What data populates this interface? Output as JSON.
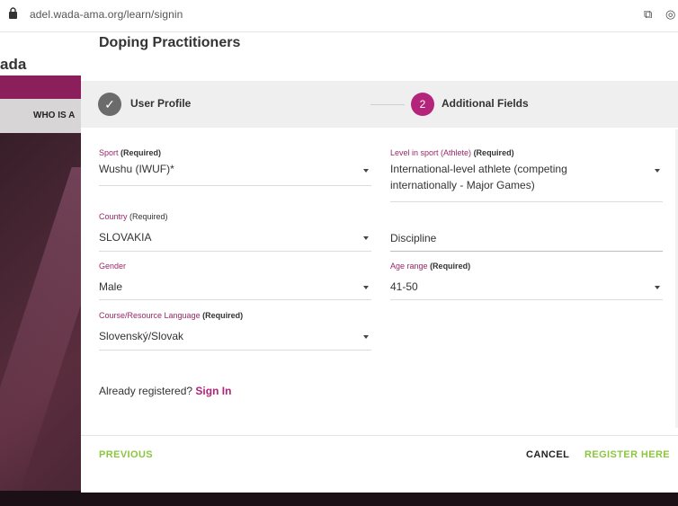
{
  "browser": {
    "url": "adel.wada-ama.org/learn/signin"
  },
  "background": {
    "logo_text": "ada",
    "nav_text": "WHO IS A"
  },
  "modal": {
    "title": "Doping Practitioners",
    "steps": [
      {
        "number": "✓",
        "label": "User Profile",
        "state": "complete"
      },
      {
        "number": "2",
        "label": "Additional Fields",
        "state": "active"
      }
    ],
    "fields": {
      "sport": {
        "label": "Sport",
        "required": "(Required)",
        "value": "Wushu (IWUF)*"
      },
      "level": {
        "label": "Level in sport (Athlete)",
        "required": "(Required)",
        "value_line1": "International-level athlete (competing",
        "value_line2": "internationally - Major Games)"
      },
      "country": {
        "label": "Country",
        "required": "(Required)",
        "value": "SLOVAKIA"
      },
      "discipline": {
        "placeholder": "Discipline"
      },
      "gender": {
        "label": "Gender",
        "value": "Male"
      },
      "age_range": {
        "label": "Age range",
        "required": "(Required)",
        "value": "41-50"
      },
      "language": {
        "label": "Course/Resource Language",
        "required": "(Required)",
        "value": "Slovenský/Slovak"
      }
    },
    "signin": {
      "prompt": "Already registered?",
      "link": "Sign In"
    },
    "footer": {
      "previous": "PREVIOUS",
      "cancel": "CANCEL",
      "register": "REGISTER HERE"
    }
  },
  "colors": {
    "accent": "#b4247a",
    "label": "#9a2768",
    "action_green": "#8cc63f"
  }
}
